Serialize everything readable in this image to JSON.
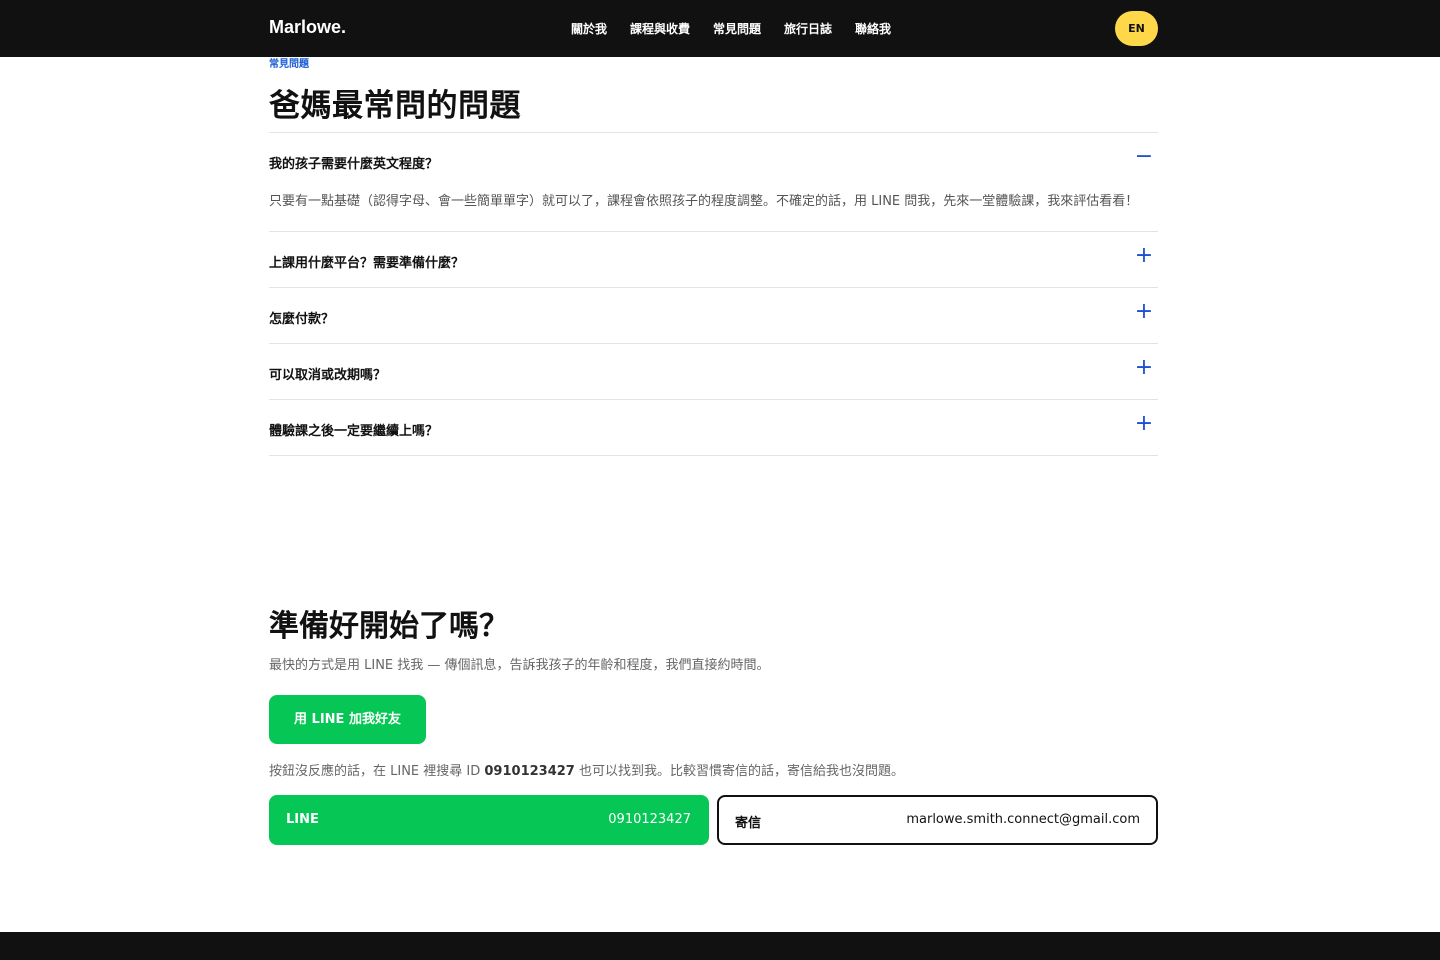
{
  "header": {
    "logo": "Marlowe.",
    "nav": [
      "關於我",
      "課程與收費",
      "常見問題",
      "旅行日誌",
      "聯絡我"
    ],
    "lang_label": "EN"
  },
  "faq_section": {
    "eyebrow": "常見問題",
    "title": "爸媽最常問的問題",
    "items": [
      {
        "question": "我的孩子需要什麼英文程度？",
        "answer": "只要有一點基礎（認得字母、會一些簡單單字）就可以了，課程會依照孩子的程度調整。不確定的話，用 LINE 問我，先來一堂體驗課，我來評估看看！",
        "expanded": true,
        "icon": "−"
      },
      {
        "question": "上課用什麼平台？需要準備什麼？",
        "expanded": false,
        "icon": "+"
      },
      {
        "question": "怎麼付款？",
        "expanded": false,
        "icon": "+"
      },
      {
        "question": "可以取消或改期嗎？",
        "expanded": false,
        "icon": "+"
      },
      {
        "question": "體驗課之後一定要繼續上嗎？",
        "expanded": false,
        "icon": "+"
      }
    ]
  },
  "cta_section": {
    "title": "準備好開始了嗎？",
    "lead": "最快的方式是用 LINE 找我 — 傳個訊息，告訴我孩子的年齡和程度，我們直接約時間。",
    "button_label": "用 LINE 加我好友",
    "hint_prefix": "按鈕沒反應的話，在 LINE 裡搜尋 ID ",
    "hint_id": "0910123427",
    "hint_suffix": " 也可以找到我。比較習慣寄信的話，寄信給我也沒問題。",
    "line_card": {
      "label": "LINE",
      "value": "0910123427"
    },
    "mail_card": {
      "label": "寄信",
      "value": "marlowe.smith.connect@gmail.com"
    }
  },
  "colors": {
    "topbar": "#111111",
    "accent_blue": "#1f4fd0",
    "line_green": "#06c755",
    "lang_yellow": "#ffd84a"
  }
}
